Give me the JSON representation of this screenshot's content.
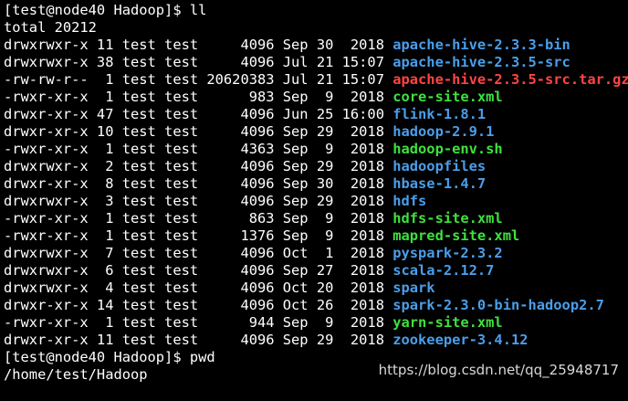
{
  "prompt1": "[test@node40 Hadoop]$ ll",
  "total": "total 20212",
  "entries": [
    {
      "meta": "drwxrwxr-x 11 test test     4096 Sep 30  2018 ",
      "name": "apache-hive-2.3.3-bin",
      "type": "dir"
    },
    {
      "meta": "drwxrwxr-x 38 test test     4096 Jul 21 15:07 ",
      "name": "apache-hive-2.3.5-src",
      "type": "dir"
    },
    {
      "meta": "-rw-rw-r--  1 test test 20620383 Jul 21 15:07 ",
      "name": "apache-hive-2.3.5-src.tar.gz",
      "type": "archive"
    },
    {
      "meta": "-rwxr-xr-x  1 test test      983 Sep  9  2018 ",
      "name": "core-site.xml",
      "type": "exec"
    },
    {
      "meta": "drwxr-xr-x 47 test test     4096 Jun 25 16:00 ",
      "name": "flink-1.8.1",
      "type": "dir"
    },
    {
      "meta": "drwxr-xr-x 10 test test     4096 Sep 29  2018 ",
      "name": "hadoop-2.9.1",
      "type": "dir"
    },
    {
      "meta": "-rwxr-xr-x  1 test test     4363 Sep  9  2018 ",
      "name": "hadoop-env.sh",
      "type": "exec"
    },
    {
      "meta": "drwxrwxr-x  2 test test     4096 Sep 29  2018 ",
      "name": "hadoopfiles",
      "type": "dir"
    },
    {
      "meta": "drwxr-xr-x  8 test test     4096 Sep 30  2018 ",
      "name": "hbase-1.4.7",
      "type": "dir"
    },
    {
      "meta": "drwxrwxr-x  3 test test     4096 Sep 29  2018 ",
      "name": "hdfs",
      "type": "dir"
    },
    {
      "meta": "-rwxr-xr-x  1 test test      863 Sep  9  2018 ",
      "name": "hdfs-site.xml",
      "type": "exec"
    },
    {
      "meta": "-rwxr-xr-x  1 test test     1376 Sep  9  2018 ",
      "name": "mapred-site.xml",
      "type": "exec"
    },
    {
      "meta": "drwxrwxr-x  7 test test     4096 Oct  1  2018 ",
      "name": "pyspark-2.3.2",
      "type": "dir"
    },
    {
      "meta": "drwxrwxr-x  6 test test     4096 Sep 27  2018 ",
      "name": "scala-2.12.7",
      "type": "dir"
    },
    {
      "meta": "drwxrwxr-x  4 test test     4096 Oct 20  2018 ",
      "name": "spark",
      "type": "dir"
    },
    {
      "meta": "drwxr-xr-x 14 test test     4096 Oct 26  2018 ",
      "name": "spark-2.3.0-bin-hadoop2.7",
      "type": "dir"
    },
    {
      "meta": "-rwxr-xr-x  1 test test      944 Sep  9  2018 ",
      "name": "yarn-site.xml",
      "type": "exec"
    },
    {
      "meta": "drwxr-xr-x 11 test test     4096 Sep 29  2018 ",
      "name": "zookeeper-3.4.12",
      "type": "dir"
    }
  ],
  "prompt2": "[test@node40 Hadoop]$ pwd",
  "pwd_output": "/home/test/Hadoop",
  "watermark": "https://blog.csdn.net/qq_25948717",
  "colors": {
    "background": "#000000",
    "text": "#ffffff",
    "directory": "#4a9eea",
    "executable": "#3fe03f",
    "archive": "#ff4444"
  }
}
